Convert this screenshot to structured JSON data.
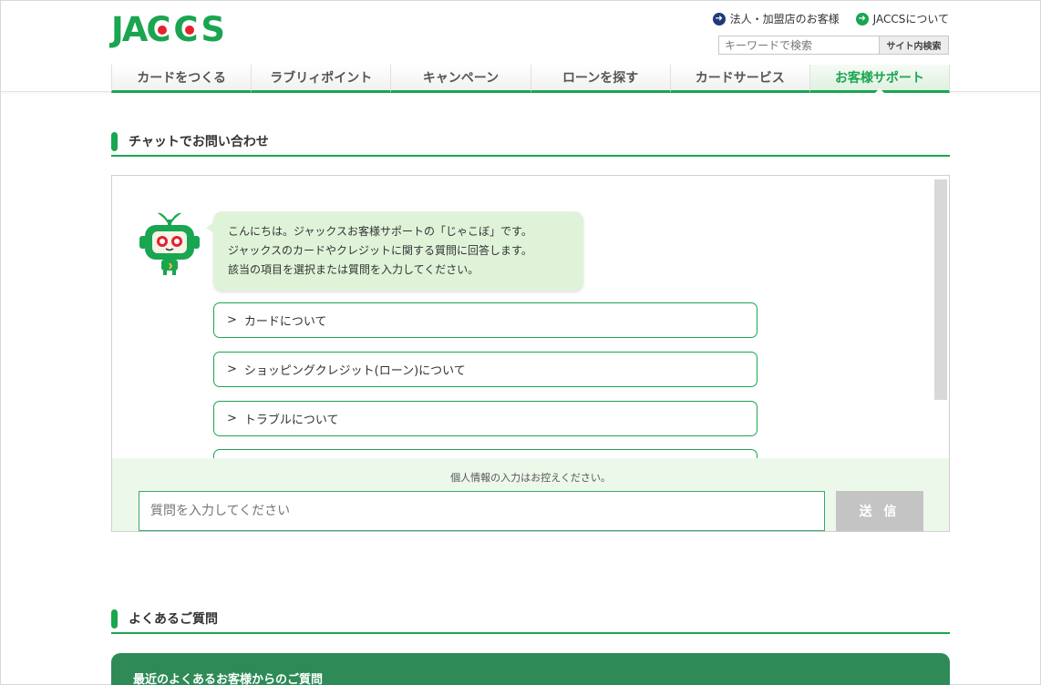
{
  "header": {
    "logo_text_left": "JA",
    "logo_text_c": "C",
    "logo_text_right": "S",
    "util_links": [
      {
        "label": "法人・加盟店のお客様",
        "icon": "arrow-right-circle-icon",
        "color": "#1f3a7a"
      },
      {
        "label": "JACCSについて",
        "icon": "arrow-right-circle-icon",
        "color": "#1aa550"
      }
    ],
    "search": {
      "placeholder": "キーワードで検索",
      "button_label": "サイト内検索"
    }
  },
  "nav": {
    "tabs": [
      {
        "label": "カードをつくる",
        "active": false
      },
      {
        "label": "ラブリィポイント",
        "active": false
      },
      {
        "label": "キャンペーン",
        "active": false
      },
      {
        "label": "ローンを探す",
        "active": false
      },
      {
        "label": "カードサービス",
        "active": false
      },
      {
        "label": "お客様サポート",
        "active": true
      }
    ]
  },
  "chat_section": {
    "title": "チャットでお問い合わせ",
    "bot_message": [
      "こんにちは。ジャックスお客様サポートの「じゃこぼ」です。",
      "ジャックスのカードやクレジットに関する質問に回答します。",
      "該当の項目を選択または質問を入力してください。"
    ],
    "options": [
      {
        "chevron": ">",
        "label": "カードについて"
      },
      {
        "chevron": ">",
        "label": "ショッピングクレジット(ローン)について"
      },
      {
        "chevron": ">",
        "label": "トラブルについて"
      },
      {
        "chevron": "",
        "label": ""
      }
    ],
    "notice": "個人情報の入力はお控えください。",
    "input_placeholder": "質問を入力してください",
    "send_label": "送 信"
  },
  "faq_section": {
    "title": "よくあるご質問",
    "panel_title": "最近のよくあるお客様からのご質問"
  },
  "colors": {
    "brand_green": "#1aa550",
    "logo_red": "#e4222a",
    "bubble_bg": "#dff3d9",
    "input_area_bg": "#ecf8ea",
    "faq_panel": "#2e8b57"
  }
}
